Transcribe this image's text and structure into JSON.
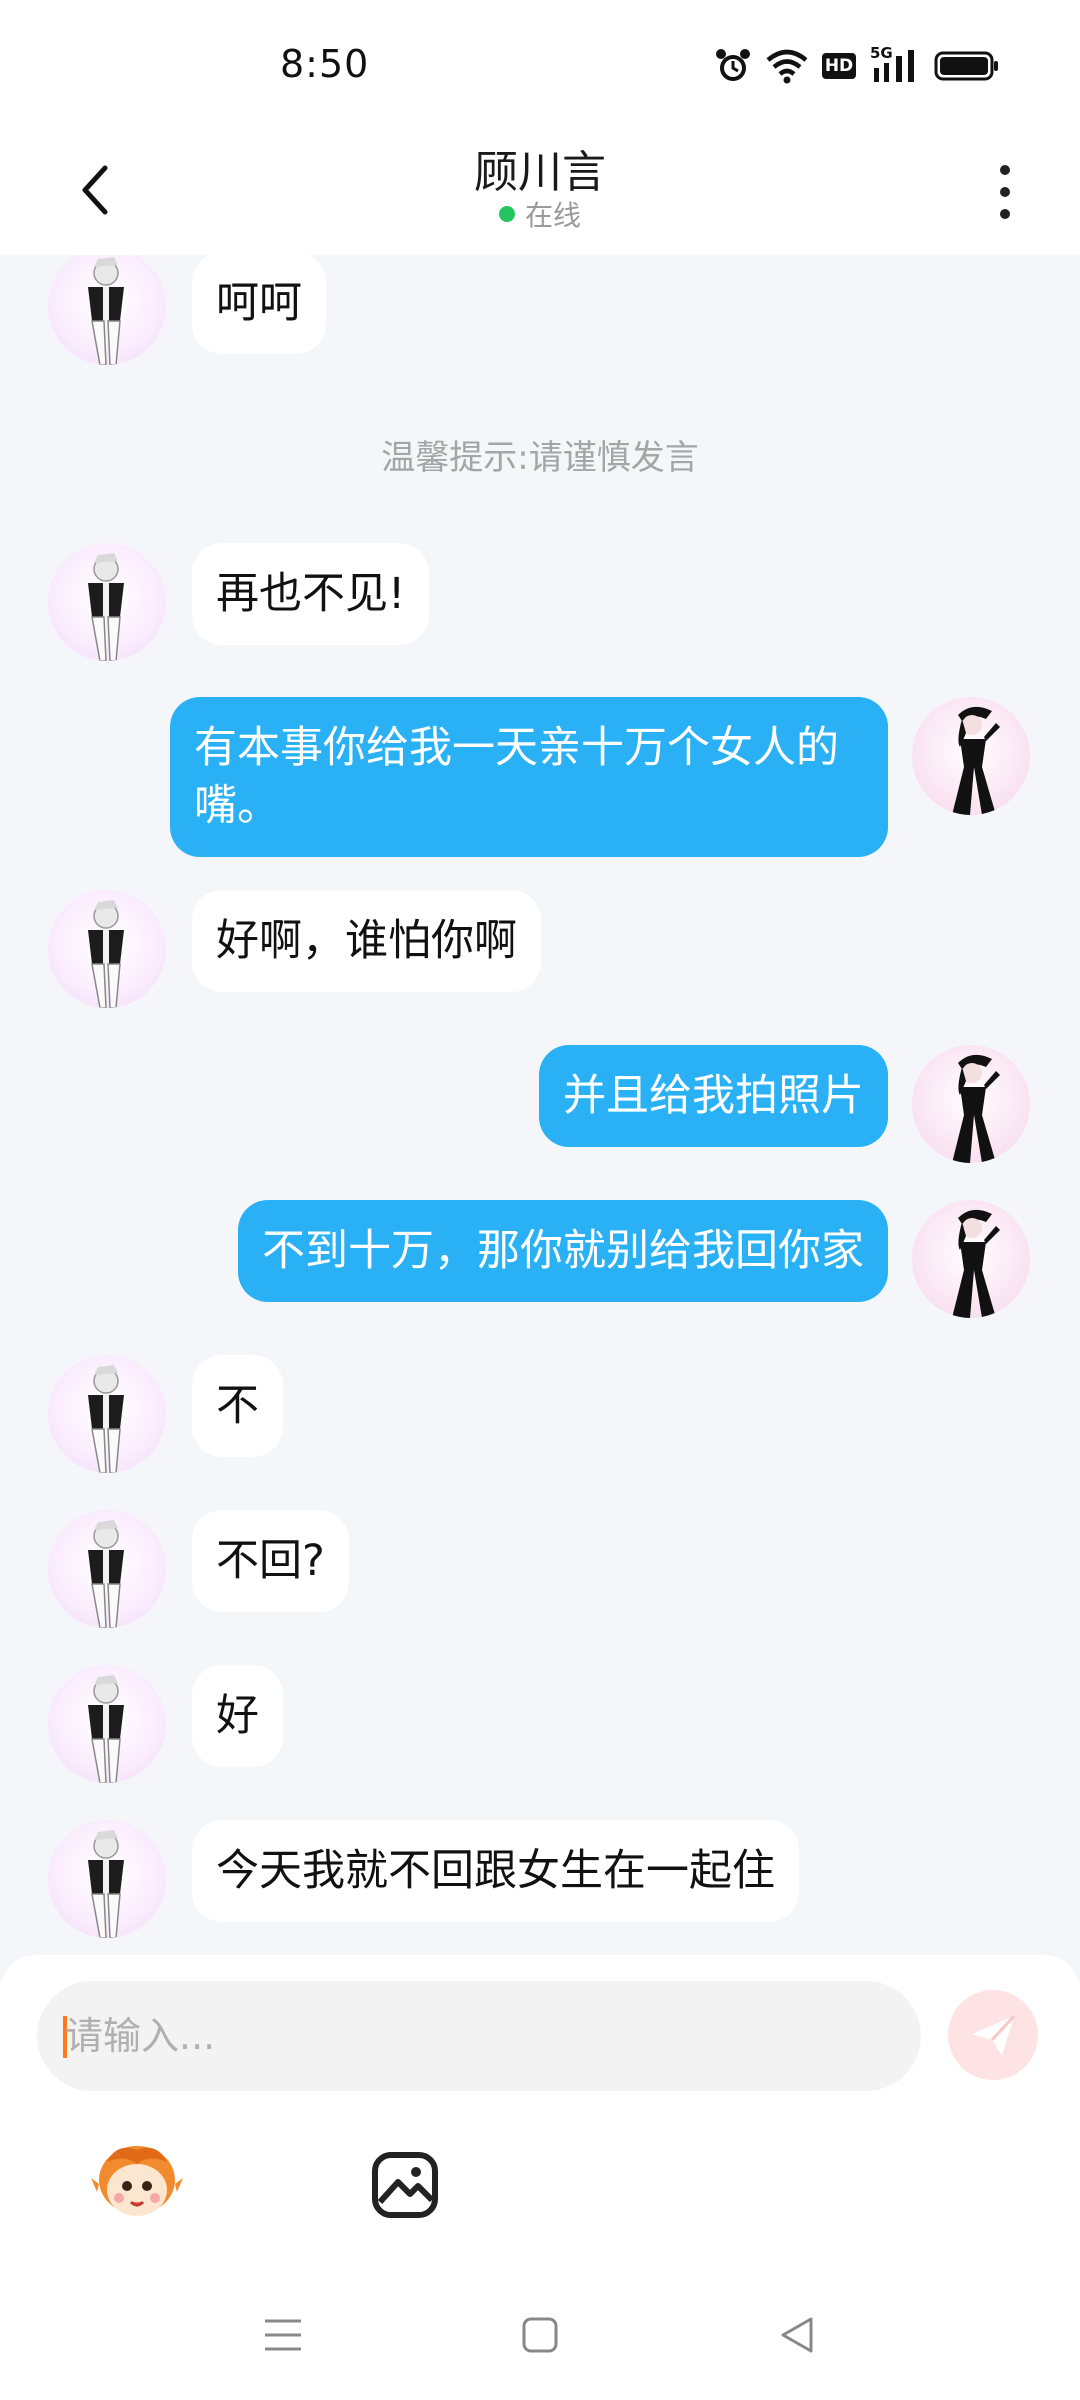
{
  "status_bar": {
    "time": "8:50",
    "hd_label": "HD",
    "network_label": "5G",
    "icons": [
      "alarm-icon",
      "wifi-icon",
      "hd-icon",
      "signal-icon",
      "battery-icon"
    ]
  },
  "header": {
    "title": "顾川言",
    "status": "在线",
    "status_color": "#22c55e",
    "back_icon": "chevron-left-icon",
    "more_icon": "more-vertical-icon"
  },
  "chat": {
    "messages": [
      {
        "side": "in",
        "text": "呵呵"
      },
      {
        "type": "tip",
        "text": "温馨提示:请谨慎发言"
      },
      {
        "side": "in",
        "text": "再也不见!"
      },
      {
        "side": "out",
        "text": "有本事你给我一天亲十万个女人的嘴。"
      },
      {
        "side": "in",
        "text": "好啊，谁怕你啊"
      },
      {
        "side": "out",
        "text": "并且给我拍照片"
      },
      {
        "side": "out",
        "text": "不到十万，那你就别给我回你家"
      },
      {
        "side": "in",
        "text": "不"
      },
      {
        "side": "in",
        "text": "不回?"
      },
      {
        "side": "in",
        "text": "好"
      },
      {
        "side": "in",
        "text": "今天我就不回跟女生在一起住"
      }
    ]
  },
  "composer": {
    "placeholder": "请输入...",
    "value": "",
    "send_icon": "send-icon",
    "tools": [
      "emoji-sticker-icon",
      "image-icon"
    ]
  },
  "colors": {
    "outgoing_bubble": "#2ab1f5",
    "incoming_bubble": "#ffffff",
    "background": "#f4f6f9",
    "send_button_bg": "#fde3e4"
  },
  "nav_bar": {
    "buttons": [
      "menu-icon",
      "home-icon",
      "back-triangle-icon"
    ]
  }
}
